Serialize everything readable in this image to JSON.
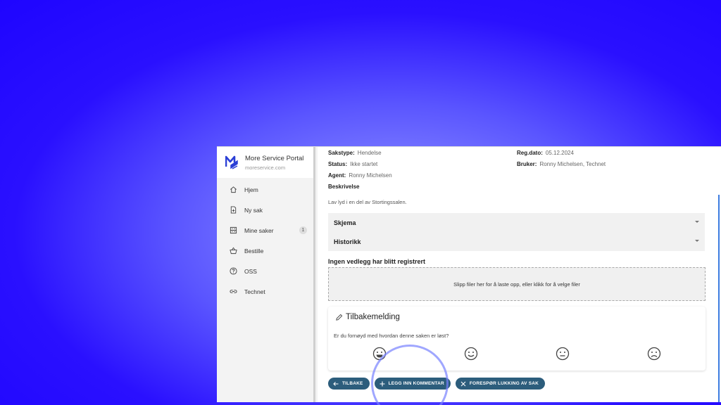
{
  "brand": {
    "title": "More Service Portal",
    "subtitle": "moreservice.com"
  },
  "sidebar": {
    "items": [
      {
        "label": "Hjem",
        "icon": "home-icon"
      },
      {
        "label": "Ny sak",
        "icon": "new-case-icon"
      },
      {
        "label": "Mine saker",
        "icon": "cases-icon",
        "badge": "1"
      },
      {
        "label": "Bestille",
        "icon": "basket-icon"
      },
      {
        "label": "OSS",
        "icon": "help-icon"
      },
      {
        "label": "Technet",
        "icon": "link-icon"
      }
    ]
  },
  "details": {
    "sakstype": {
      "label": "Sakstype:",
      "value": "Hendelse"
    },
    "status": {
      "label": "Status:",
      "value": "Ikke startet"
    },
    "agent": {
      "label": "Agent:",
      "value": "Ronny Michelsen"
    },
    "regdato": {
      "label": "Reg.dato:",
      "value": "05.12.2024"
    },
    "bruker": {
      "label": "Bruker:",
      "value": "Ronny Michelsen, Technet"
    },
    "beskrivelse_label": "Beskrivelse",
    "beskrivelse_text": "Lav lyd i en del av Stortingssalen."
  },
  "accordions": {
    "skjema": "Skjema",
    "historikk": "Historikk"
  },
  "attachments": {
    "title": "Ingen vedlegg har blitt registrert",
    "dropzone": "Slipp filer her for å laste opp, eller klikk for å velge filer"
  },
  "feedback": {
    "title": "Tilbakemelding",
    "question": "Er du fornøyd med hvordan denne saken er løst?"
  },
  "actions": {
    "back": "TILBAKE",
    "comment": "LEGG INN KOMMENTAR",
    "close": "FORESPØR LUKKING AV SAK"
  },
  "colors": {
    "accent": "#2c5d7c",
    "logo": "#2b3fd6"
  }
}
